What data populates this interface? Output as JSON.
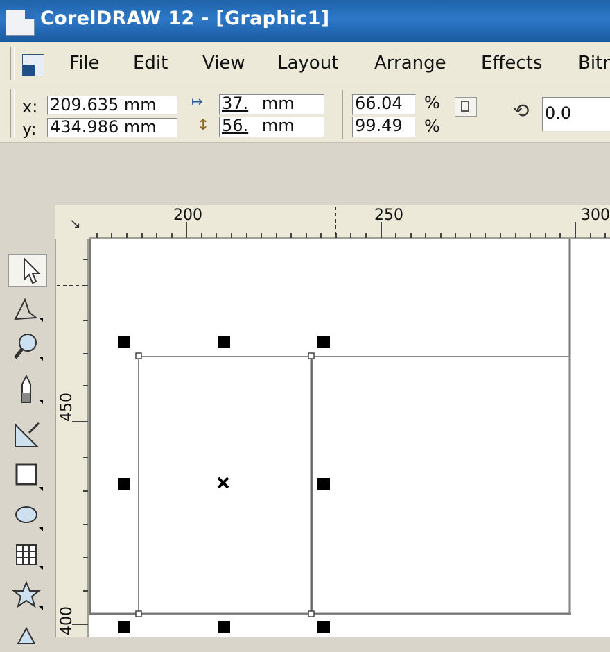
{
  "window": {
    "title": "CorelDRAW 12 - [Graphic1]"
  },
  "menu": {
    "items": [
      "File",
      "Edit",
      "View",
      "Layout",
      "Arrange",
      "Effects",
      "Bitm"
    ]
  },
  "property_bar": {
    "x_label": "x:",
    "x_value": "209.635 mm",
    "y_label": "y:",
    "y_value": "434.986 mm",
    "width_value": "37.",
    "width_unit": "mm",
    "height_value": "56.",
    "height_unit": "mm",
    "scale_x": "66.04",
    "scale_y": "99.49",
    "percent_symbol": "%",
    "rotation": "0.0"
  },
  "ruler": {
    "horizontal_labels": [
      "200",
      "250",
      "300"
    ],
    "vertical_labels": [
      "450",
      "400"
    ]
  },
  "toolbox": {
    "tools": [
      "pick-tool-icon",
      "shape-tool-icon",
      "zoom-tool-icon",
      "freehand-tool-icon",
      "smart-fill-tool-icon",
      "rectangle-tool-icon",
      "ellipse-tool-icon",
      "graph-paper-tool-icon",
      "star-shape-tool-icon",
      "basic-shapes-tool-icon"
    ]
  },
  "colors": {
    "titlebar": "#2d78c8",
    "chrome": "#ece9d8",
    "workspace": "#d9d5cb"
  }
}
